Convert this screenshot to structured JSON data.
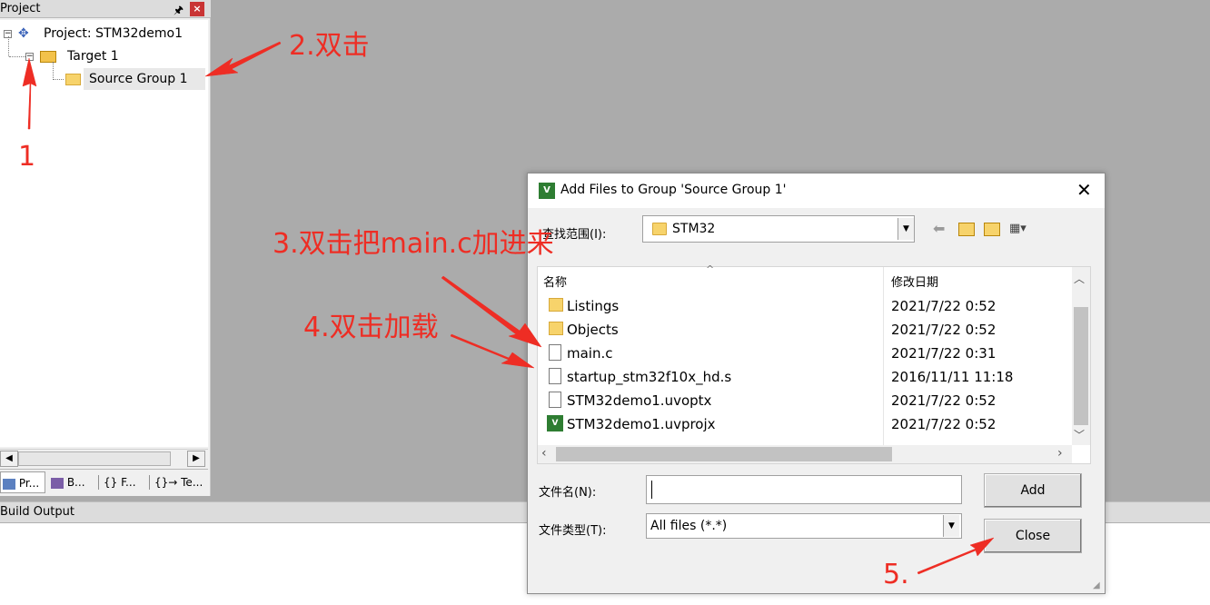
{
  "project_panel": {
    "title": "Project",
    "pin_glyph": "ᵠ",
    "close_glyph": "×",
    "tree": {
      "project": "Project: STM32demo1",
      "target": "Target 1",
      "source_group": "Source Group 1"
    },
    "tabs": [
      "Pr...",
      "B...",
      "{} F...",
      "{}→ Te..."
    ]
  },
  "build_output": {
    "title": "Build Output"
  },
  "dialog": {
    "title": "Add Files to Group 'Source Group 1'",
    "look_in_label": "查找范围(I):",
    "look_in_value": "STM32",
    "columns": {
      "name": "名称",
      "date": "修改日期"
    },
    "files": [
      {
        "name": "Listings",
        "date": "2021/7/22 0:52",
        "icon": "folder-icon"
      },
      {
        "name": "Objects",
        "date": "2021/7/22 0:52",
        "icon": "folder-icon"
      },
      {
        "name": "main.c",
        "date": "2021/7/22 0:31",
        "icon": "file-icon"
      },
      {
        "name": "startup_stm32f10x_hd.s",
        "date": "2016/11/11 11:18",
        "icon": "file-icon"
      },
      {
        "name": "STM32demo1.uvoptx",
        "date": "2021/7/22 0:52",
        "icon": "file-icon"
      },
      {
        "name": "STM32demo1.uvprojx",
        "date": "2021/7/22 0:52",
        "icon": "uvision-project-icon"
      }
    ],
    "file_name_label": "文件名(N):",
    "file_name_value": "",
    "file_type_label": "文件类型(T):",
    "file_type_value": "All files (*.*)",
    "add_button": "Add",
    "close_button": "Close"
  },
  "annotations": {
    "step1": "1",
    "step2": "2.双击",
    "step3": "3.双击把main.c加进来",
    "step4": "4.双击加载",
    "step5": "5."
  },
  "colors": {
    "annotation": "#ee2d24",
    "workspace": "#ababab",
    "dialog_bg": "#f0f0f0"
  }
}
